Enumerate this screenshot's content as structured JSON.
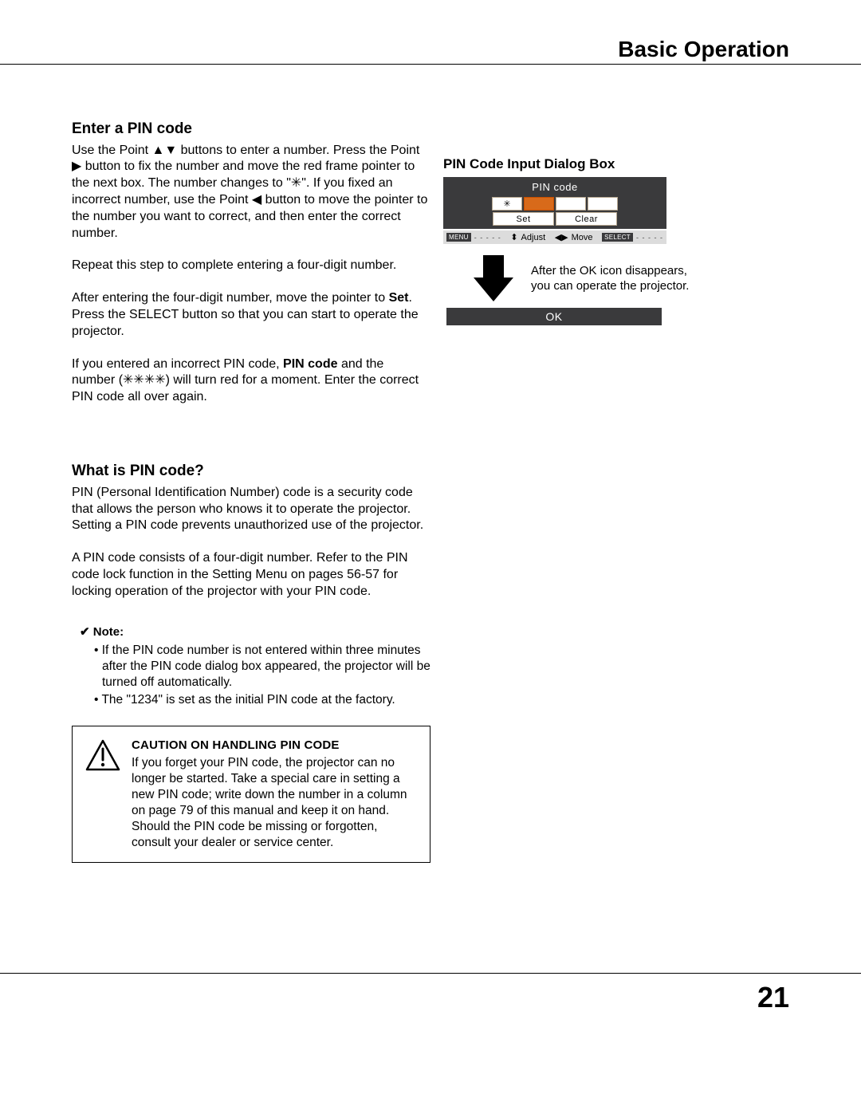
{
  "section_header": "Basic Operation",
  "page_number": "21",
  "left": {
    "h1": "Enter a PIN code",
    "p1a": "Use the Point ",
    "p1_updown": "▲▼",
    "p1b": " buttons to enter a number. Press the Point ",
    "p1_right": "▶",
    "p1c": " button to fix the number and move the red frame pointer to the next box. The number changes to \"✳\". If you fixed an incorrect number, use the Point ",
    "p1_left": "◀",
    "p1d": " button to move the pointer to the number you want to correct, and then enter the correct number.",
    "p2": "Repeat this step to complete entering a four-digit number.",
    "p3a": "After entering the four-digit number, move the pointer to ",
    "p3_set": "Set",
    "p3b": ". Press the SELECT button so that you can start to operate the projector.",
    "p4a": "If you entered an incorrect PIN code, ",
    "p4_pin": "PIN code",
    "p4b": " and the number (✳✳✳✳) will turn red for a moment. Enter the correct PIN code all over again.",
    "h2": "What is PIN code?",
    "p5": "PIN (Personal Identification Number) code is a security code that allows the person who knows it to operate the projector. Setting a PIN code prevents unauthorized use of the projector.",
    "p6": "A PIN code consists of a four-digit number. Refer to the PIN code lock function in the Setting Menu on pages 56-57 for locking operation of the projector with your PIN code.",
    "note_label": "Note:",
    "note1": "If the PIN code number is not entered within three minutes after the PIN code dialog box appeared, the projector will be turned off automatically.",
    "note2": "The \"1234\" is set as the initial PIN code at the factory."
  },
  "caution": {
    "title": "CAUTION ON HANDLING PIN CODE",
    "body": "If you forget your PIN code, the projector can no longer be started. Take a special care in setting a new PIN code; write down the number in a column on page 79 of this manual and keep it on hand. Should the PIN code be missing or forgotten, consult your dealer or service center."
  },
  "right": {
    "title": "PIN Code Input Dialog Box",
    "dialog_head": "PIN code",
    "cell1": "✳",
    "set": "Set",
    "clear": "Clear",
    "menu_badge": "MENU",
    "dashes": "- - - - -",
    "adjust_glyph": "⬍",
    "adjust": "Adjust",
    "move_glyph": "◀▶",
    "move": "Move",
    "select_badge": "SELECT",
    "caption": "After the OK icon disappears, you can operate the projector.",
    "ok": "OK"
  }
}
